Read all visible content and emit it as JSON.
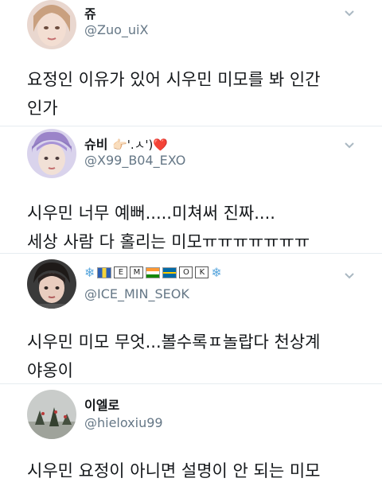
{
  "tweets": [
    {
      "name": "쥬",
      "handle": "@Zuo_uiX",
      "text_line1": "요정인 이유가 있어 시우민 미모를 봐 인간",
      "text_line2": "인가"
    },
    {
      "name": "슈비",
      "name_emoji": "👉🏻'.ㅅ')❤️",
      "handle": "@X99_B04_EXO",
      "text_line1": "시우민 너무 예뻐.....미쳐써 진짜....",
      "text_line2": "세상 사람 다 홀리는 미모ㅠㅠㅠㅠㅠㅠㅠ"
    },
    {
      "name_letters": [
        "E",
        "M",
        "O",
        "K"
      ],
      "handle": "@ICE_MIN_SEOK",
      "text_line1": "시우민 미모 무엇...볼수록ㅍ놀랍다 천상계",
      "text_line2": "야옹이"
    },
    {
      "name": "이엘로",
      "handle": "@hieloxiu99",
      "text_line1": "시우민 요정이 아니면 설명이 안 되는 미모"
    }
  ],
  "icons": {
    "caret": "chevron-down-icon",
    "snowflake": "snowflake-icon"
  },
  "colors": {
    "text": "#14171a",
    "secondary": "#657786",
    "divider": "#e6ecf0",
    "heart": "#e0245e"
  }
}
